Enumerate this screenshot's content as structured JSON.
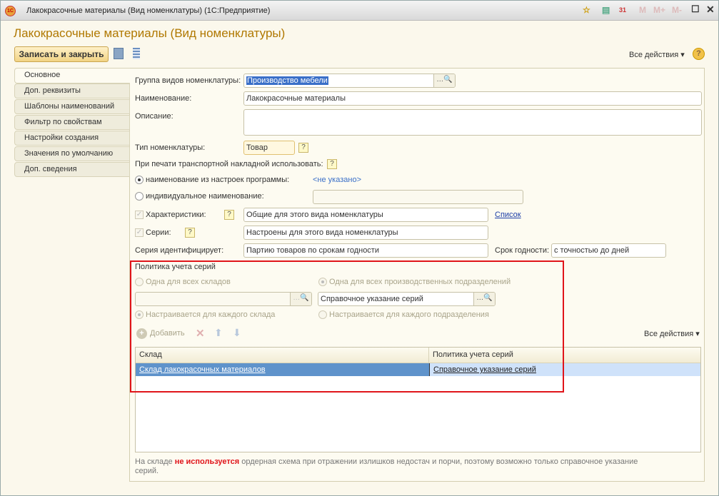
{
  "window": {
    "title": "Лакокрасочные материалы (Вид номенклатуры)  (1С:Предприятие)",
    "toolbar_icons": [
      "favorite-icon",
      "calculator-icon",
      "calendar-icon",
      "M",
      "M+",
      "M-",
      "maximize-icon",
      "close-icon"
    ],
    "calendar_day": "31"
  },
  "form": {
    "title": "Лакокрасочные материалы (Вид номенклатуры)",
    "save_close": "Записать и закрыть",
    "all_actions": "Все действия ▾",
    "help": "?"
  },
  "tabs": [
    "Основное",
    "Доп. реквизиты",
    "Шаблоны наименований",
    "Фильтр по свойствам",
    "Настройки создания",
    "Значения по умолчанию",
    "Доп. сведения"
  ],
  "fields": {
    "group_label": "Группа видов номенклатуры:",
    "group_value": "Производство мебели",
    "name_label": "Наименование:",
    "name_value": "Лакокрасочные материалы",
    "desc_label": "Описание:",
    "type_label": "Тип номенклатуры:",
    "type_value": "Товар",
    "print_label": "При печати транспортной накладной использовать:",
    "radio_settings": "наименование из настроек программы:",
    "not_set": "<не указано>",
    "radio_individual": "индивидуальное наименование:",
    "chars_label": "Характеристики:",
    "chars_value": "Общие для этого вида номенклатуры",
    "list_link": "Список",
    "series_label": "Серии:",
    "series_value": "Настроены для этого вида номенклатуры",
    "ident_label": "Серия идентифицирует:",
    "ident_value": "Партию товаров по срокам годности",
    "expiry_label": "Срок годности:",
    "expiry_value": "с точностью до дней"
  },
  "policy": {
    "title": "Политика учета серий",
    "one_wh": "Одна для всех складов",
    "one_div": "Одна для всех производственных подразделений",
    "div_value": "Справочное указание серий",
    "each_wh": "Настраивается для каждого склада",
    "each_div": "Настраивается для каждого подразделения",
    "add": "Добавить",
    "all_actions": "Все действия ▾",
    "columns": [
      "Склад",
      "Политика учета серий"
    ],
    "rows": [
      [
        "Склад лакокрасочных материалов",
        "Справочное указание серий"
      ]
    ]
  },
  "note": {
    "before": "На складе ",
    "bold": "не используется",
    "after": " ордерная схема при отражении излишков недостач и порчи, поэтому возможно только справочное указание серий."
  }
}
